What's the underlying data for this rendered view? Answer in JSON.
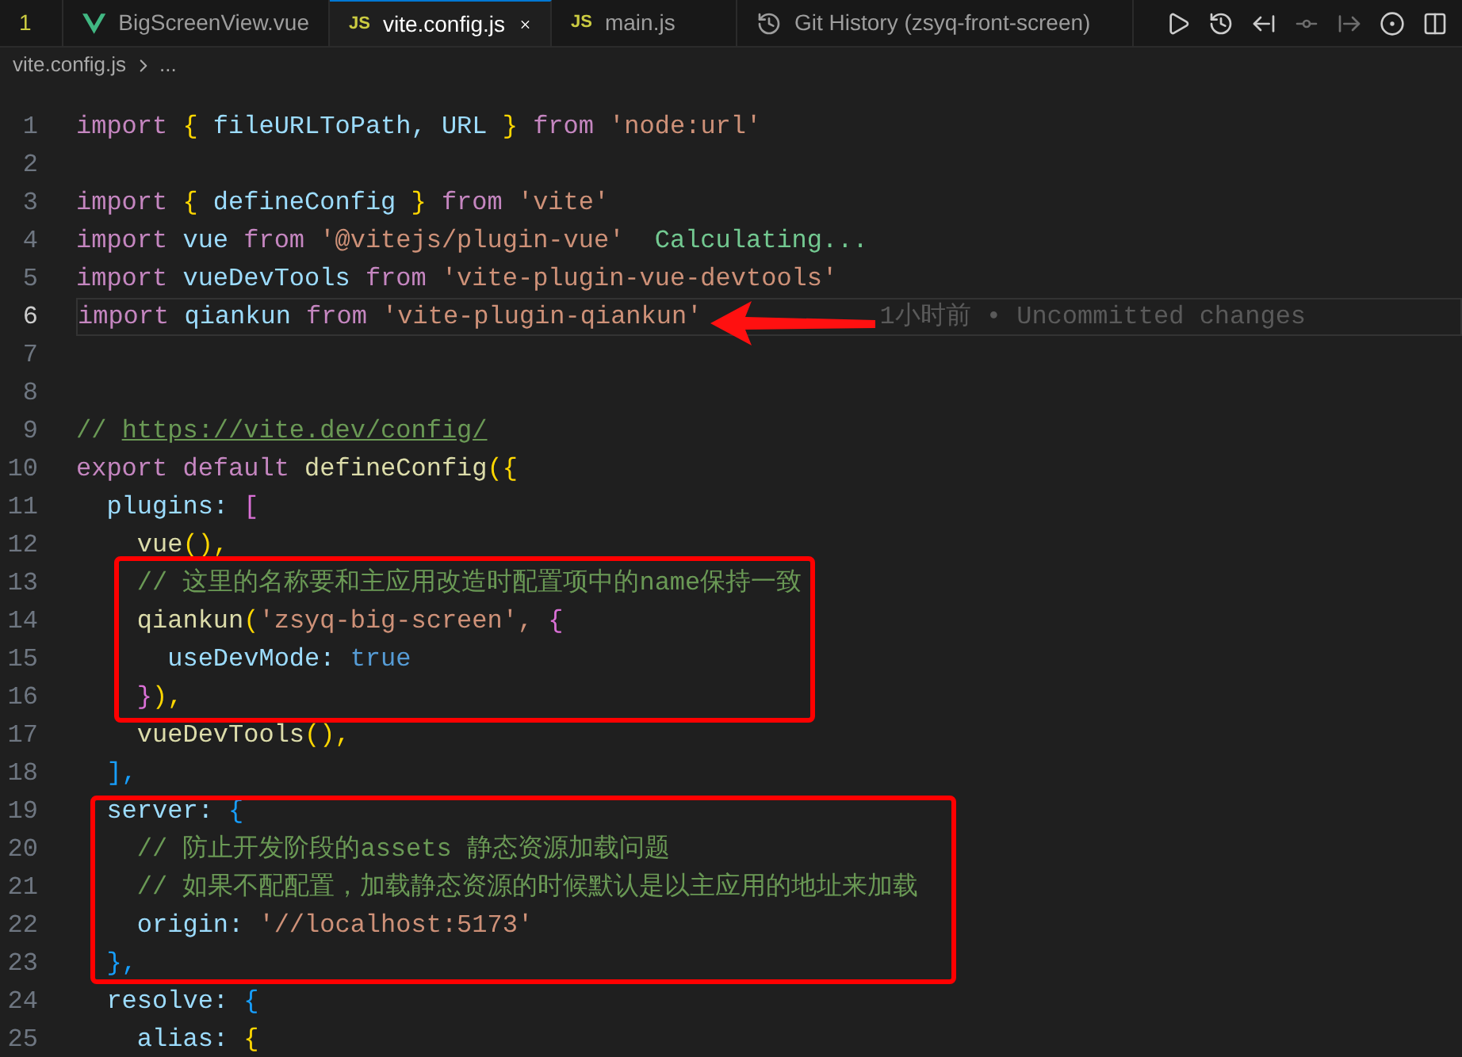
{
  "tabs": [
    {
      "label": "1",
      "kind": "partial",
      "selected": false
    },
    {
      "label": "BigScreenView.vue",
      "kind": "vue",
      "selected": false
    },
    {
      "label": "vite.config.js",
      "kind": "js",
      "badge": "JS",
      "selected": true
    },
    {
      "label": "main.js",
      "kind": "js",
      "badge": "JS",
      "selected": false
    },
    {
      "label": "Git History (zsyq-front-screen)",
      "kind": "history",
      "selected": false
    }
  ],
  "breadcrumb": {
    "file": "vite.config.js",
    "rest": "..."
  },
  "lines": [
    {
      "number": "1",
      "active": false,
      "tokens": [
        {
          "t": "import ",
          "kind": "kw"
        },
        {
          "t": "{ ",
          "kind": "b1"
        },
        {
          "t": "fileURLToPath, URL ",
          "kind": "var"
        },
        {
          "t": "} ",
          "kind": "b1"
        },
        {
          "t": "from ",
          "kind": "kw"
        },
        {
          "t": "'node:url'",
          "kind": "str"
        }
      ]
    },
    {
      "number": "2",
      "active": false
    },
    {
      "number": "3",
      "active": false,
      "tokens": [
        {
          "t": "import ",
          "kind": "kw"
        },
        {
          "t": "{ ",
          "kind": "b1"
        },
        {
          "t": "defineConfig ",
          "kind": "var"
        },
        {
          "t": "} ",
          "kind": "b1"
        },
        {
          "t": "from ",
          "kind": "kw"
        },
        {
          "t": "'vite'",
          "kind": "str"
        }
      ]
    },
    {
      "number": "4",
      "active": false,
      "tokens": [
        {
          "t": "import ",
          "kind": "kw"
        },
        {
          "t": "vue ",
          "kind": "var"
        },
        {
          "t": "from ",
          "kind": "kw"
        },
        {
          "t": "'@vitejs/plugin-vue'  ",
          "kind": "str"
        },
        {
          "t": "Calculating...",
          "kind": "lens"
        }
      ]
    },
    {
      "number": "5",
      "active": false,
      "tokens": [
        {
          "t": "import ",
          "kind": "kw"
        },
        {
          "t": "vueDevTools ",
          "kind": "var"
        },
        {
          "t": "from ",
          "kind": "kw"
        },
        {
          "t": "'vite-plugin-vue-devtools'",
          "kind": "str"
        }
      ]
    },
    {
      "number": "6",
      "active": true,
      "blame": "1小时前 • Uncommitted changes",
      "tokens": [
        {
          "t": "import ",
          "kind": "kw"
        },
        {
          "t": "qiankun ",
          "kind": "var"
        },
        {
          "t": "from ",
          "kind": "kw"
        },
        {
          "t": "'vite-plugin-qiankun'",
          "kind": "str"
        }
      ]
    },
    {
      "number": "7",
      "active": false
    },
    {
      "number": "8",
      "active": false
    },
    {
      "number": "9",
      "active": false,
      "tokens": [
        {
          "t": "// ",
          "kind": "comment"
        },
        {
          "t": "https://vite.dev/config/",
          "kind": "link"
        }
      ]
    },
    {
      "number": "10",
      "active": false,
      "tokens": [
        {
          "t": "export default ",
          "kind": "kw"
        },
        {
          "t": "defineConfig",
          "kind": "fn"
        },
        {
          "t": "({",
          "kind": "b1"
        }
      ]
    },
    {
      "number": "11",
      "active": false,
      "tokens": [
        {
          "t": "  plugins: ",
          "kind": "var"
        },
        {
          "t": "[",
          "kind": "b2"
        }
      ]
    },
    {
      "number": "12",
      "active": false,
      "tokens": [
        {
          "t": "    vue",
          "kind": "fn"
        },
        {
          "t": "(),",
          "kind": "b1"
        }
      ]
    },
    {
      "number": "13",
      "active": false,
      "tokens": [
        {
          "t": "    // 这里的名称要和主应用改造时配置项中的name保持一致",
          "kind": "comment"
        }
      ]
    },
    {
      "number": "14",
      "active": false,
      "tokens": [
        {
          "t": "    qiankun",
          "kind": "fn"
        },
        {
          "t": "(",
          "kind": "b1"
        },
        {
          "t": "'zsyq-big-screen', ",
          "kind": "str"
        },
        {
          "t": "{",
          "kind": "b2"
        }
      ]
    },
    {
      "number": "15",
      "active": false,
      "tokens": [
        {
          "t": "      useDevMode: ",
          "kind": "var"
        },
        {
          "t": "true",
          "kind": "bool"
        }
      ]
    },
    {
      "number": "16",
      "active": false,
      "tokens": [
        {
          "t": "    }",
          "kind": "b2"
        },
        {
          "t": "),",
          "kind": "b1"
        }
      ]
    },
    {
      "number": "17",
      "active": false,
      "tokens": [
        {
          "t": "    vueDevTools",
          "kind": "fn"
        },
        {
          "t": "(),",
          "kind": "b1"
        }
      ]
    },
    {
      "number": "18",
      "active": false,
      "tokens": [
        {
          "t": "  ],",
          "kind": "b3"
        }
      ]
    },
    {
      "number": "19",
      "active": false,
      "tokens": [
        {
          "t": "  server: ",
          "kind": "var"
        },
        {
          "t": "{",
          "kind": "b3"
        }
      ]
    },
    {
      "number": "20",
      "active": false,
      "tokens": [
        {
          "t": "    // 防止开发阶段的assets 静态资源加载问题",
          "kind": "comment"
        }
      ]
    },
    {
      "number": "21",
      "active": false,
      "tokens": [
        {
          "t": "    // 如果不配配置，加载静态资源的时候默认是以主应用的地址来加载",
          "kind": "comment"
        }
      ]
    },
    {
      "number": "22",
      "active": false,
      "tokens": [
        {
          "t": "    origin: ",
          "kind": "var"
        },
        {
          "t": "'//localhost:5173'",
          "kind": "str"
        }
      ]
    },
    {
      "number": "23",
      "active": false,
      "tokens": [
        {
          "t": "  },",
          "kind": "b3"
        }
      ]
    },
    {
      "number": "24",
      "active": false,
      "tokens": [
        {
          "t": "  resolve: ",
          "kind": "var"
        },
        {
          "t": "{",
          "kind": "b3"
        }
      ]
    },
    {
      "number": "25",
      "active": false,
      "tokens": [
        {
          "t": "    alias: ",
          "kind": "var"
        },
        {
          "t": "{",
          "kind": "b1"
        }
      ]
    }
  ]
}
